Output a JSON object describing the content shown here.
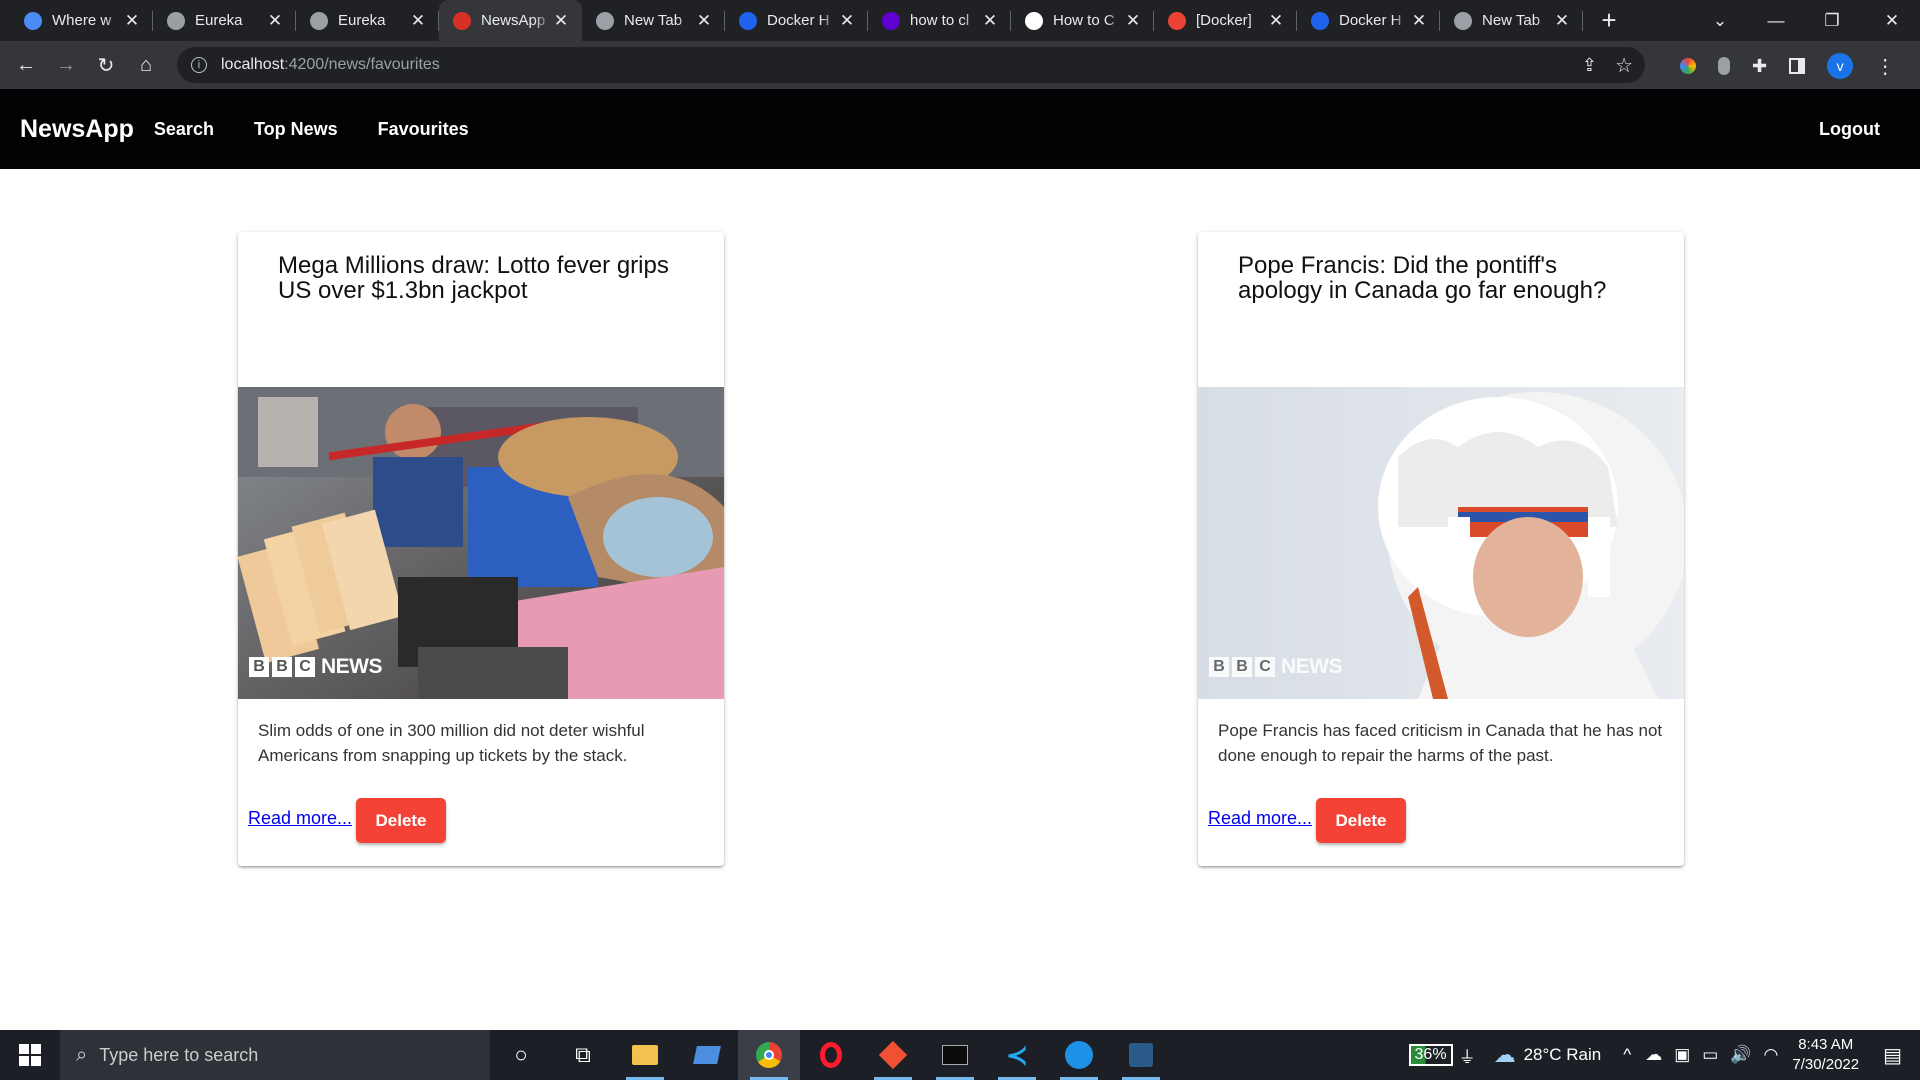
{
  "browser": {
    "tabs": [
      {
        "title": "Where w",
        "favicon_color": "#4a8bf5",
        "icon": "slack-icon"
      },
      {
        "title": "Eureka",
        "favicon_color": "#9aa0a6",
        "icon": "globe-icon"
      },
      {
        "title": "Eureka",
        "favicon_color": "#9aa0a6",
        "icon": "globe-icon"
      },
      {
        "title": "NewsApp",
        "favicon_color": "#d93025",
        "icon": "newsapp-icon",
        "active": true
      },
      {
        "title": "New Tab",
        "favicon_color": "#9aa0a6",
        "icon": "globe-icon"
      },
      {
        "title": "Docker H",
        "favicon_color": "#1d63ed",
        "icon": "docker-icon"
      },
      {
        "title": "how to cl",
        "favicon_color": "#6001d2",
        "icon": "yahoo-icon"
      },
      {
        "title": "How to C",
        "favicon_color": "#ffffff",
        "icon": "github-icon"
      },
      {
        "title": "[Docker]",
        "favicon_color": "#ea4335",
        "icon": "gmail-icon"
      },
      {
        "title": "Docker H",
        "favicon_color": "#1d63ed",
        "icon": "docker-icon"
      },
      {
        "title": "New Tab",
        "favicon_color": "#9aa0a6",
        "icon": "globe-icon"
      }
    ],
    "url_host": "localhost",
    "url_path": ":4200/news/favourites",
    "profile_initial": "v"
  },
  "app": {
    "brand": "NewsApp",
    "nav": {
      "search": "Search",
      "top_news": "Top News",
      "favourites": "Favourites",
      "logout": "Logout"
    }
  },
  "cards": [
    {
      "title": "Mega Millions draw: Lotto fever grips US over $1.3bn jackpot",
      "description": "Slim odds of one in 300 million did not deter wishful Americans from snapping up tickets by the stack.",
      "read_more": "Read more...",
      "delete": "Delete",
      "watermark": "NEWS"
    },
    {
      "title": "Pope Francis: Did the pontiff's apology in Canada go far enough?",
      "description": "Pope Francis has faced criticism in Canada that he has not done enough to repair the harms of the past.",
      "read_more": "Read more...",
      "delete": "Delete",
      "watermark": "NEWS"
    }
  ],
  "taskbar": {
    "search_placeholder": "Type here to search",
    "battery": "36%",
    "weather": "28°C  Rain",
    "time": "8:43 AM",
    "date": "7/30/2022"
  }
}
